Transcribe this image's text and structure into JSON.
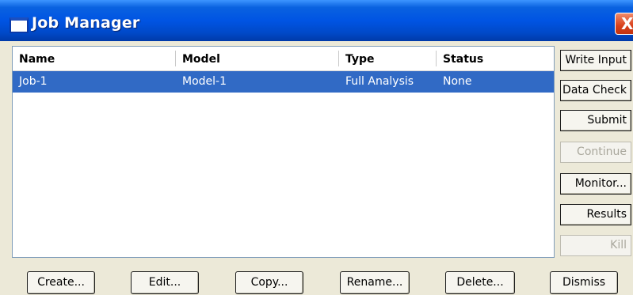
{
  "window": {
    "title": "Job Manager",
    "close_label": "X"
  },
  "table": {
    "columns": [
      "Name",
      "Model",
      "Type",
      "Status"
    ],
    "rows": [
      {
        "name": "Job-1",
        "model": "Model-1",
        "type": "Full Analysis",
        "status": "None",
        "selected": true
      }
    ]
  },
  "side_buttons": [
    {
      "label": "Write Input",
      "enabled": true
    },
    {
      "label": "Data Check",
      "enabled": true
    },
    {
      "label": "Submit",
      "enabled": true
    },
    {
      "label": "Continue",
      "enabled": false
    },
    {
      "label": "Monitor...",
      "enabled": true
    },
    {
      "label": "Results",
      "enabled": true
    },
    {
      "label": "Kill",
      "enabled": false
    }
  ],
  "bottom_buttons": [
    {
      "label": "Create..."
    },
    {
      "label": "Edit..."
    },
    {
      "label": "Copy..."
    },
    {
      "label": "Rename..."
    },
    {
      "label": "Delete..."
    },
    {
      "label": "Dismiss"
    }
  ],
  "colors": {
    "titlebar": "#0054e3",
    "selection": "#316ac5",
    "close_button": "#d8401b",
    "dialog_background": "#ece9d8"
  }
}
